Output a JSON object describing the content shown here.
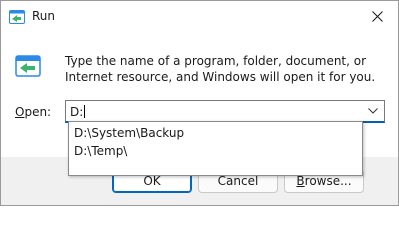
{
  "window": {
    "title": "Run",
    "icon": "run-app-icon",
    "close_icon": "close-icon"
  },
  "description": "Type the name of a program, folder, document, or Internet resource, and Windows will open it for you.",
  "open": {
    "label_accel": "O",
    "label_rest": "pen:",
    "value": "D:"
  },
  "dropdown": {
    "items": [
      "D:\\System\\Backup",
      "D:\\Temp\\"
    ]
  },
  "buttons": {
    "ok": "OK",
    "cancel": "Cancel",
    "browse_accel": "B",
    "browse_rest": "rowse..."
  },
  "colors": {
    "accent": "#005fb8",
    "footer_bg": "#f0f0f0",
    "icon_blue": "#2a8ae6",
    "icon_green": "#3cb371"
  }
}
